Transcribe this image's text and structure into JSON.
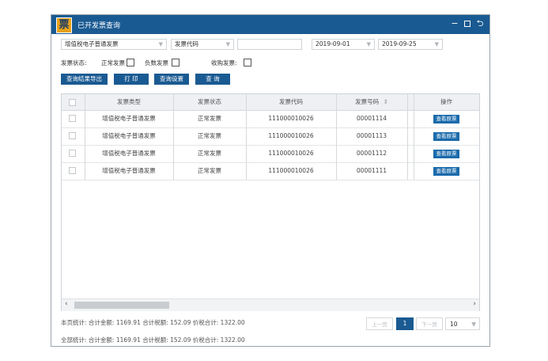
{
  "titlebar": {
    "logo_glyph": "票",
    "title": "已开发票查询",
    "min_glyph": "−",
    "back_glyph": "⮌"
  },
  "filters": {
    "invoice_type_select": "增值税电子普通发票",
    "code_type_select": "发票代码",
    "code_input": "",
    "date_from": "2019-09-01",
    "date_to": "2019-09-25",
    "status_label": "发票状态:",
    "normal_label": "正常发票",
    "negative_label": "负数发票",
    "purchase_label": "收购发票:"
  },
  "toolbar": {
    "export_label": "查询结果导出",
    "print_label": "打 印",
    "settings_label": "查询设置",
    "query_label": "查 询"
  },
  "table": {
    "headers": [
      "发票类型",
      "发票状态",
      "发票代码",
      "发票号码",
      "操作"
    ],
    "sort_glyph": "⇕",
    "view_label": "查看原票",
    "rows": [
      {
        "type": "增值税电子普通发票",
        "status": "正常发票",
        "code": "111000010026",
        "number": "00001114"
      },
      {
        "type": "增值税电子普通发票",
        "status": "正常发票",
        "code": "111000010026",
        "number": "00001113"
      },
      {
        "type": "增值税电子普通发票",
        "status": "正常发票",
        "code": "111000010026",
        "number": "00001112"
      },
      {
        "type": "增值税电子普通发票",
        "status": "正常发票",
        "code": "111000010026",
        "number": "00001111"
      }
    ]
  },
  "summary": {
    "page_total": "本页统计:  合计金额:  1169.91   合计税额:  152.09   价税合计:  1322.00",
    "all_total": "全部统计:  合计金额:  1169.91   合计税额:  152.09   价税合计:  1322.00"
  },
  "pager": {
    "prev": "上一页",
    "current": "1",
    "next": "下一页",
    "page_size": "10"
  },
  "colors": {
    "accent": "#1a5a92",
    "button": "#1a6aab"
  }
}
